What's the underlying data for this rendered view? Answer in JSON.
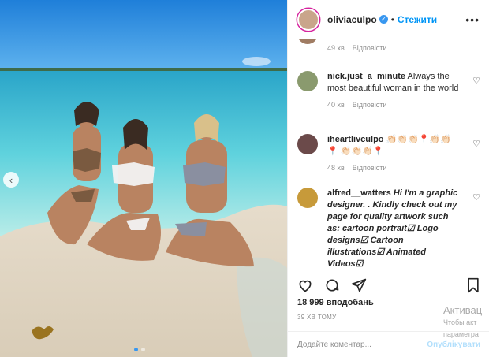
{
  "post": {
    "username": "oliviaculpo",
    "verified_mark": "✓",
    "separator": "•",
    "follow_label": "Стежити",
    "more_label": "•••"
  },
  "comments": [
    {
      "username": "",
      "text": "",
      "time": "49 хв",
      "reply_label": "Відповісти"
    },
    {
      "username": "nick.just_a_minute",
      "text": "Always the most beautiful woman in the world",
      "time": "40 хв",
      "reply_label": "Відповісти"
    },
    {
      "username": "iheartlivculpo",
      "text": "👏🏻👏🏻👏🏻📍👏🏻👏🏻📍 👏🏻👏🏻👏🏻📍",
      "time": "48 хв",
      "reply_label": "Відповісти"
    },
    {
      "username": "alfred__watters",
      "text": "Hi I'm a graphic designer. . Kindly check out my page for quality artwork such as: cartoon portrait☑ Logo designs☑ Cartoon illustrations☑ Animated Videos☑"
    }
  ],
  "likes": "18 999 вподобань",
  "time_ago": "39 ХВ ТОМУ",
  "add_comment": {
    "placeholder": "Додайте коментар...",
    "publish_label": "Опублікувати"
  },
  "icons": [
    "heart-icon",
    "comment-icon",
    "share-icon",
    "bookmark-icon",
    "chevron-left-icon",
    "more-icon"
  ],
  "windows_overlay": {
    "title": "Активац",
    "line1": "Чтобы акт",
    "line2": "параметра"
  },
  "colors": {
    "accent": "#0095f6",
    "text": "#262626",
    "muted": "#8e8e8e",
    "verified": "#3897f0"
  }
}
